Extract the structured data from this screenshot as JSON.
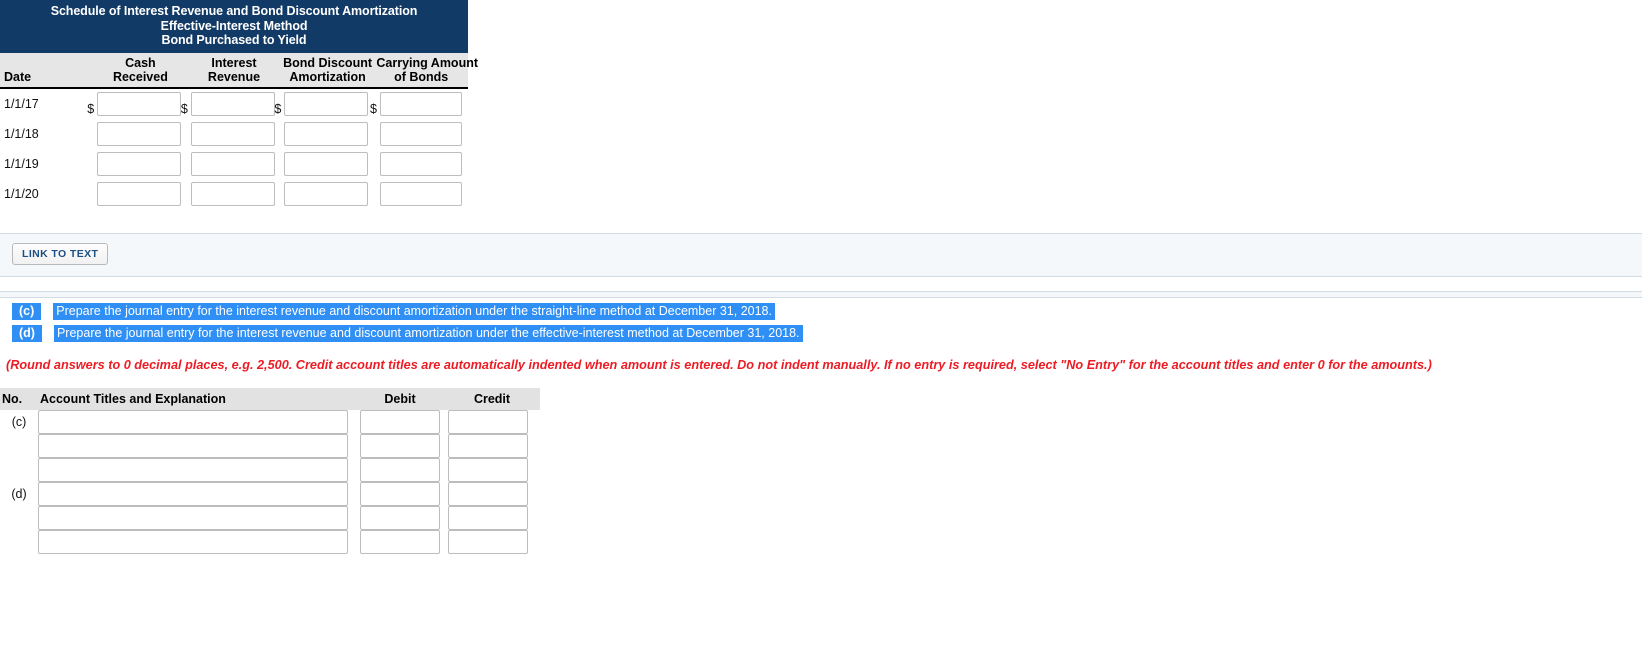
{
  "schedule": {
    "title_lines": [
      "Schedule of Interest Revenue and Bond Discount Amortization",
      "Effective-Interest Method",
      "Bond Purchased to Yield"
    ],
    "columns": [
      {
        "key": "date",
        "lines": [
          "",
          "Date"
        ]
      },
      {
        "key": "cash",
        "lines": [
          "Cash",
          "Received"
        ]
      },
      {
        "key": "interest",
        "lines": [
          "Interest",
          "Revenue"
        ]
      },
      {
        "key": "discount",
        "lines": [
          "Bond Discount",
          "Amortization"
        ]
      },
      {
        "key": "carrying",
        "lines": [
          "Carrying Amount",
          "of Bonds"
        ]
      }
    ],
    "currency_symbol": "$",
    "rows": [
      {
        "date": "1/1/17",
        "show_dollar": true,
        "cash": "",
        "interest": "",
        "discount": "",
        "carrying": ""
      },
      {
        "date": "1/1/18",
        "show_dollar": false,
        "cash": "",
        "interest": "",
        "discount": "",
        "carrying": ""
      },
      {
        "date": "1/1/19",
        "show_dollar": false,
        "cash": "",
        "interest": "",
        "discount": "",
        "carrying": ""
      },
      {
        "date": "1/1/20",
        "show_dollar": false,
        "cash": "",
        "interest": "",
        "discount": "",
        "carrying": ""
      }
    ]
  },
  "link_panel": {
    "button_label": "LINK TO TEXT"
  },
  "questions": [
    {
      "label": "(c)",
      "text": "Prepare the journal entry for the interest revenue and discount amortization under the straight-line method at December 31, 2018."
    },
    {
      "label": "(d)",
      "text": "Prepare the journal entry for the interest revenue and discount amortization under the effective-interest method at December 31, 2018."
    }
  ],
  "red_note": "(Round answers to 0 decimal places, e.g. 2,500. Credit account titles are automatically indented when amount is entered. Do not indent manually. If no entry is required, select \"No Entry\" for the account titles and enter 0 for the amounts.)",
  "journal": {
    "headers": {
      "no": "No.",
      "account": "Account Titles and Explanation",
      "debit": "Debit",
      "credit": "Credit"
    },
    "rows": [
      {
        "no": "(c)",
        "account": "",
        "debit": "",
        "credit": ""
      },
      {
        "no": "",
        "account": "",
        "debit": "",
        "credit": ""
      },
      {
        "no": "",
        "account": "",
        "debit": "",
        "credit": ""
      },
      {
        "no": "(d)",
        "account": "",
        "debit": "",
        "credit": ""
      },
      {
        "no": "",
        "account": "",
        "debit": "",
        "credit": ""
      },
      {
        "no": "",
        "account": "",
        "debit": "",
        "credit": ""
      }
    ]
  },
  "colors": {
    "schedule_header_bg": "#123A66",
    "column_header_bg": "#e6e6e6",
    "highlight_blue": "#2f8ff5",
    "note_red": "#ed1c24",
    "panel_bg": "#f4f8fb",
    "link_button_text": "#1c4f84"
  }
}
